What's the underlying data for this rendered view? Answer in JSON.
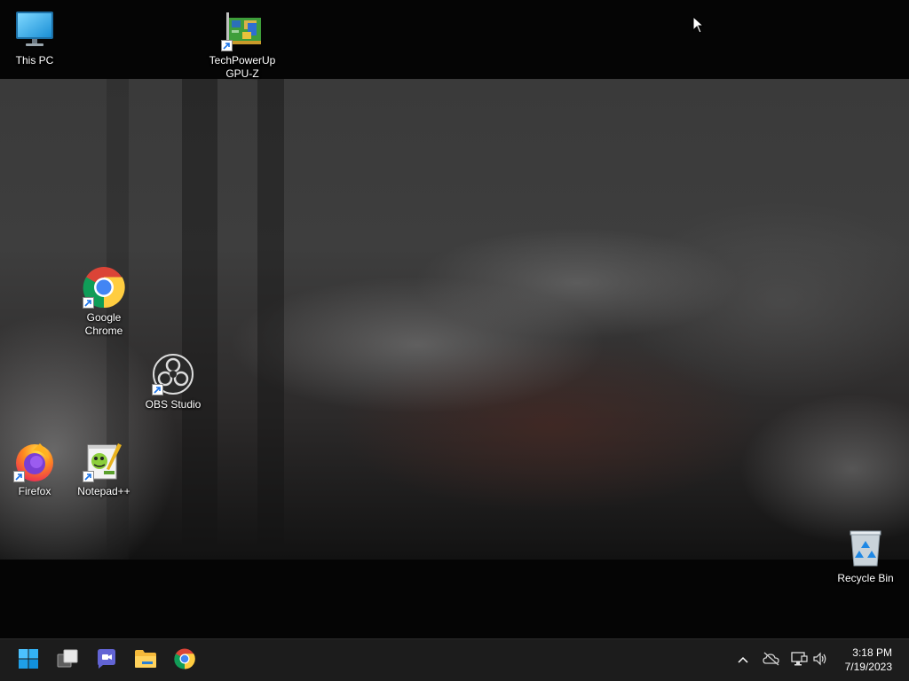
{
  "desktop": {
    "icons": [
      {
        "label": "This PC",
        "icon": "monitor-icon",
        "shortcut": false
      },
      {
        "label": "TechPowerUp GPU-Z",
        "icon": "gpu-card-icon",
        "shortcut": true
      },
      {
        "label": "Google Chrome",
        "icon": "chrome-icon",
        "shortcut": true
      },
      {
        "label": "OBS Studio",
        "icon": "obs-icon",
        "shortcut": true
      },
      {
        "label": "Firefox",
        "icon": "firefox-icon",
        "shortcut": true
      },
      {
        "label": "Notepad++",
        "icon": "notepad-plus-plus-icon",
        "shortcut": true
      },
      {
        "label": "Recycle Bin",
        "icon": "recycle-bin-icon",
        "shortcut": false
      }
    ]
  },
  "taskbar": {
    "pinned": [
      {
        "name": "Start",
        "icon": "windows-logo-icon"
      },
      {
        "name": "Task View",
        "icon": "task-view-icon"
      },
      {
        "name": "Chat",
        "icon": "teams-chat-icon"
      },
      {
        "name": "File Explorer",
        "icon": "folder-icon"
      },
      {
        "name": "Google Chrome",
        "icon": "chrome-icon"
      }
    ],
    "tray": {
      "icons": [
        "chevron-up-icon",
        "onedrive-offline-icon",
        "network-icon",
        "volume-icon"
      ],
      "time": "3:18 PM",
      "date": "7/19/2023"
    }
  },
  "colors": {
    "taskbar_bg": "#1c1c1c",
    "desktop_top": "#050505",
    "windows_blue": "#0078d4"
  }
}
